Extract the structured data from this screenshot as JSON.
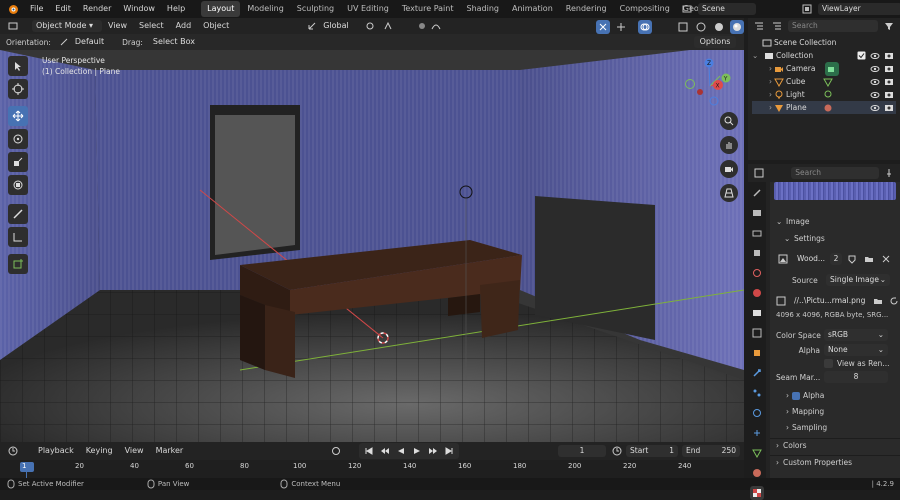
{
  "menubar": {
    "menus": [
      "File",
      "Edit",
      "Render",
      "Window",
      "Help"
    ],
    "workspaces": [
      "Layout",
      "Modeling",
      "Sculpting",
      "UV Editing",
      "Texture Paint",
      "Shading",
      "Animation",
      "Rendering",
      "Compositing",
      "Geometry Node"
    ],
    "active_workspace": "Layout",
    "scene": "Scene",
    "view_layer": "ViewLayer"
  },
  "viewport_header": {
    "mode": "Object Mode",
    "menus": [
      "View",
      "Select",
      "Add",
      "Object"
    ],
    "transform_orientation": "Global"
  },
  "tool_settings": {
    "orientation_label": "Orientation:",
    "orientation_value": "Default",
    "drag_label": "Drag:",
    "drag_value": "Select Box",
    "options_label": "Options"
  },
  "viewport": {
    "perspective_label": "User Perspective",
    "collection_label": "(1) Collection | Plane",
    "gizmo_axes": [
      "X",
      "Y",
      "Z"
    ]
  },
  "outliner": {
    "search_placeholder": "Search",
    "scene_collection": "Scene Collection",
    "collection": "Collection",
    "items": [
      {
        "name": "Camera",
        "icon": "camera-icon",
        "color": "#e89a3c"
      },
      {
        "name": "Cube",
        "icon": "mesh-icon",
        "color": "#e89a3c"
      },
      {
        "name": "Light",
        "icon": "light-icon",
        "color": "#e89a3c"
      },
      {
        "name": "Plane",
        "icon": "mesh-icon",
        "color": "#e89a3c"
      }
    ]
  },
  "properties": {
    "search_placeholder": "Search",
    "image_panel": "Image",
    "settings_panel": "Settings",
    "image_name": "Wood...",
    "user_count": "2",
    "source_label": "Source",
    "source_value": "Single Image",
    "filepath": "//..\\Pictu...rmal.png",
    "image_info": "4096 x 4096, RGBA byte, SRG...",
    "color_space_label": "Color Space",
    "color_space_value": "sRGB",
    "alpha_label": "Alpha",
    "alpha_value": "None",
    "view_as_render": "View as Ren...",
    "seam_margin_label": "Seam Mar...",
    "seam_margin_value": "8",
    "alpha_sub": "Alpha",
    "mapping": "Mapping",
    "sampling": "Sampling",
    "colors": "Colors",
    "custom_properties": "Custom Properties"
  },
  "timeline": {
    "menus": [
      "Playback",
      "Keying",
      "View",
      "Marker"
    ],
    "current_frame": "1",
    "start_label": "Start",
    "start_value": "1",
    "end_label": "End",
    "end_value": "250",
    "ticks": [
      "1",
      "20",
      "40",
      "60",
      "80",
      "100",
      "120",
      "140",
      "160",
      "180",
      "200",
      "220",
      "240"
    ]
  },
  "status": {
    "hint1": "Set Active Modifier",
    "hint2": "Pan View",
    "hint3": "Context Menu",
    "version": "4.2.9"
  },
  "colors": {
    "accent": "#4772b3",
    "object_orange": "#e89a3c"
  }
}
